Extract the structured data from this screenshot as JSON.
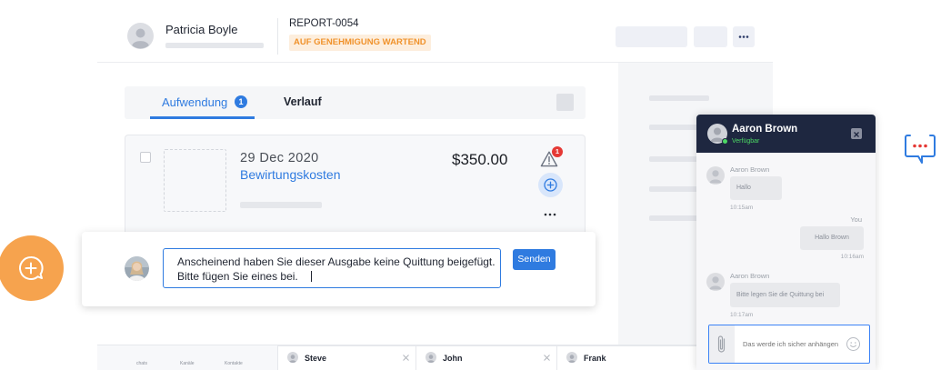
{
  "header": {
    "user_name": "Patricia Boyle",
    "report_id": "REPORT-0054",
    "status_badge": "AUF GENEHMIGUNG WARTEND"
  },
  "tabs": [
    {
      "label": "Aufwendung",
      "badge": "1",
      "active": true
    },
    {
      "label": "Verlauf",
      "active": false
    }
  ],
  "expense": {
    "date": "29 Dec 2020",
    "category": "Bewirtungskosten",
    "amount": "$350.00",
    "warning_count": "1"
  },
  "comment": {
    "line1": "Anscheinend haben Sie dieser Ausgabe keine Quittung beigefügt.",
    "line2": "Bitte fügen Sie eines bei.",
    "send_label": "Senden"
  },
  "bottom_bar": {
    "nav": [
      "chats",
      "Kanäle",
      "Kontakte"
    ],
    "chat_tabs": [
      "Steve",
      "John",
      "Frank"
    ]
  },
  "chat": {
    "contact_name": "Aaron Brown",
    "status": "Verfügbar",
    "messages": [
      {
        "sender": "Aaron Brown",
        "text": "Hallo",
        "time": "10:15am"
      },
      {
        "sender": "You",
        "text": "Hallo Brown",
        "time": "10:16am"
      },
      {
        "sender": "Aaron Brown",
        "text": "Bitte legen Sie die Quittung bei",
        "time": "10:17am"
      }
    ],
    "input_placeholder": "Das werde ich sicher anhängen"
  },
  "icons": {
    "more": "more-dots-icon",
    "warning": "warning-triangle-icon",
    "add_comment": "add-circle-icon",
    "fab": "chat-plus-icon",
    "chat_launcher": "chat-bubble-icon",
    "attach": "paperclip-icon",
    "emoji": "smiley-icon",
    "close": "close-icon"
  },
  "colors": {
    "accent": "#2f7be0",
    "status_badge_text": "#f0922b",
    "status_badge_bg": "#fdeedd",
    "fab": "#f6a34e",
    "chat_header": "#1e2740",
    "online": "#4cd964",
    "alert": "#e53935"
  }
}
